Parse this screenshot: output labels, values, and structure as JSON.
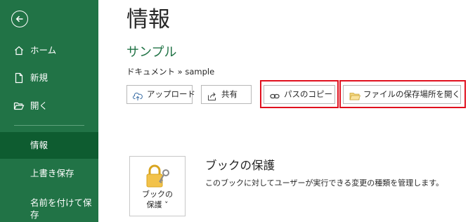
{
  "sidebar": {
    "back_icon": "back-arrow-icon",
    "items": [
      {
        "label": "ホーム",
        "icon": "home-icon"
      },
      {
        "label": "新規",
        "icon": "new-document-icon"
      },
      {
        "label": "開く",
        "icon": "folder-open-icon"
      },
      {
        "label": "情報",
        "selected": true
      },
      {
        "label": "上書き保存"
      },
      {
        "label": "名前を付けて保存"
      }
    ]
  },
  "main": {
    "title": "情報",
    "document_name": "サンプル",
    "breadcrumb": "ドキュメント » sample",
    "actions": [
      {
        "label": "アップロード",
        "icon": "upload-icon"
      },
      {
        "label": "共有",
        "icon": "share-icon"
      },
      {
        "label": "パスのコピー",
        "icon": "link-icon",
        "highlighted": true
      },
      {
        "label": "ファイルの保存場所を開く",
        "icon": "folder-icon",
        "highlighted": true
      }
    ],
    "protect": {
      "button_line1": "ブックの",
      "button_line2": "保護 ˅",
      "heading": "ブックの保護",
      "description": "このブックに対してユーザーが実行できる変更の種類を管理します。",
      "icon": "lock-key-icon"
    }
  },
  "colors": {
    "sidebar_bg": "#217346",
    "sidebar_selected": "#0e5c30",
    "accent_green": "#217346",
    "highlight_red": "#e0101e"
  }
}
